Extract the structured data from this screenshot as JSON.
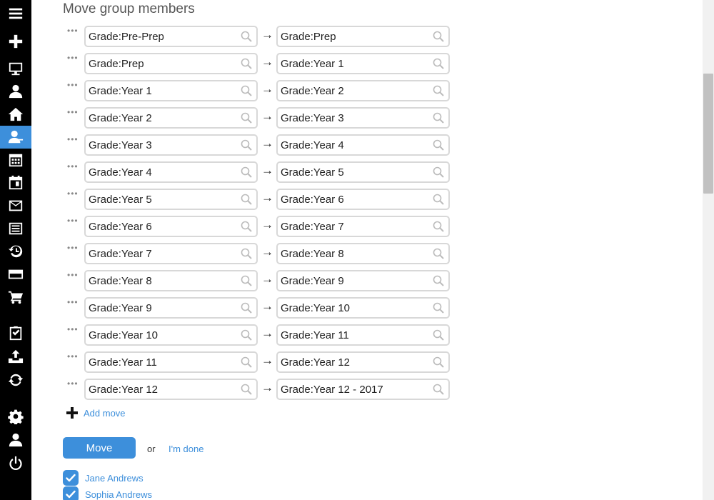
{
  "title": "Move group members",
  "moves": [
    {
      "from": "Grade:Pre-Prep",
      "to": "Grade:Prep"
    },
    {
      "from": "Grade:Prep",
      "to": "Grade:Year 1"
    },
    {
      "from": "Grade:Year 1",
      "to": "Grade:Year 2"
    },
    {
      "from": "Grade:Year 2",
      "to": "Grade:Year 3"
    },
    {
      "from": "Grade:Year 3",
      "to": "Grade:Year 4"
    },
    {
      "from": "Grade:Year 4",
      "to": "Grade:Year 5"
    },
    {
      "from": "Grade:Year 5",
      "to": "Grade:Year 6"
    },
    {
      "from": "Grade:Year 6",
      "to": "Grade:Year 7"
    },
    {
      "from": "Grade:Year 7",
      "to": "Grade:Year 8"
    },
    {
      "from": "Grade:Year 8",
      "to": "Grade:Year 9"
    },
    {
      "from": "Grade:Year 9",
      "to": "Grade:Year 10"
    },
    {
      "from": "Grade:Year 10",
      "to": "Grade:Year 11"
    },
    {
      "from": "Grade:Year 11",
      "to": "Grade:Year 12"
    },
    {
      "from": "Grade:Year 12",
      "to": "Grade:Year 12 - 2017"
    }
  ],
  "arrow": "→",
  "drag_glyph": "•••",
  "add_move_label": "Add move",
  "move_button": "Move",
  "or_text": "or",
  "done_link": "I'm done",
  "members": [
    {
      "name": "Jane Andrews",
      "checked": true
    },
    {
      "name": "Sophia Andrews",
      "checked": true
    }
  ],
  "sidebar": {
    "icons": [
      "menu-icon",
      "add-icon",
      "monitor-icon",
      "person-icon",
      "home-icon",
      "groups-icon",
      "calendar-grid-icon",
      "calendar-day-icon",
      "mail-icon",
      "keyboard-icon",
      "history-icon",
      "credit-card-icon",
      "cart-icon",
      "clipboard-check-icon",
      "upload-icon",
      "sync-icon",
      "settings-icon",
      "account-icon",
      "power-icon"
    ],
    "active": "groups-icon"
  },
  "colors": {
    "accent": "#3d8fdb",
    "sidebar": "#000000",
    "field_border": "#d8d8d8"
  }
}
